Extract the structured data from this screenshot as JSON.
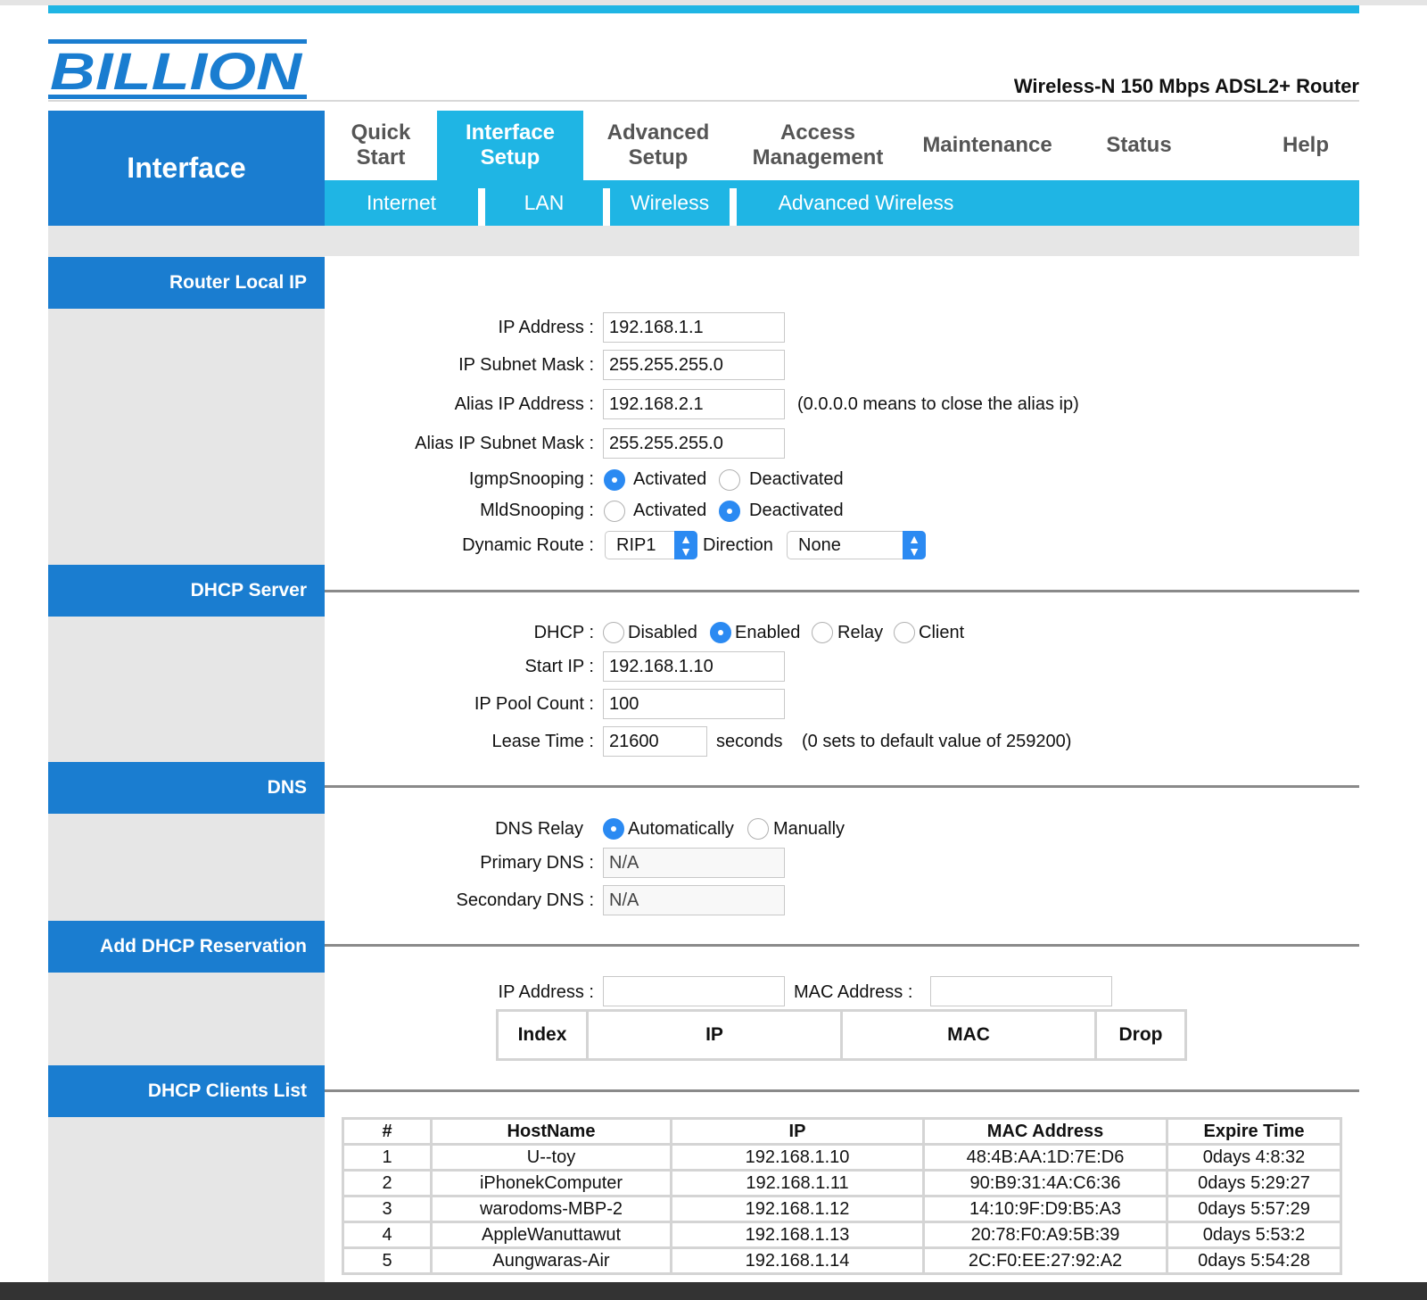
{
  "brand": {
    "logo_text": "BILLION",
    "product": "Wireless-N 150 Mbps ADSL2+ Router"
  },
  "nav": {
    "section": "Interface",
    "items": [
      {
        "label": "Quick\nStart"
      },
      {
        "label": "Interface\nSetup"
      },
      {
        "label": "Advanced\nSetup"
      },
      {
        "label": "Access\nManagement"
      },
      {
        "label": "Maintenance"
      },
      {
        "label": "Status"
      },
      {
        "label": "Help"
      }
    ],
    "subitems": [
      "Internet",
      "LAN",
      "Wireless",
      "Advanced Wireless"
    ]
  },
  "router_local_ip": {
    "header": "Router Local IP",
    "ip_label": "IP Address :",
    "ip": "192.168.1.1",
    "mask_label": "IP Subnet Mask :",
    "mask": "255.255.255.0",
    "alias_ip_label": "Alias IP Address :",
    "alias_ip": "192.168.2.1",
    "alias_note": "(0.0.0.0 means to close the alias ip)",
    "alias_mask_label": "Alias IP Subnet Mask :",
    "alias_mask": "255.255.255.0",
    "igmp_label": "IgmpSnooping :",
    "mld_label": "MldSnooping :",
    "activated": "Activated",
    "deactivated": "Deactivated",
    "igmp_value": "Activated",
    "mld_value": "Deactivated",
    "route_label": "Dynamic Route :",
    "route_value": "RIP1",
    "direction_label": "Direction",
    "direction_value": "None"
  },
  "dhcp_server": {
    "header": "DHCP Server",
    "dhcp_label": "DHCP :",
    "options": [
      "Disabled",
      "Enabled",
      "Relay",
      "Client"
    ],
    "selected": "Enabled",
    "start_ip_label": "Start IP :",
    "start_ip": "192.168.1.10",
    "pool_label": "IP Pool Count :",
    "pool": "100",
    "lease_label": "Lease Time :",
    "lease": "21600",
    "seconds": "seconds",
    "lease_note": "(0 sets to default value of 259200)"
  },
  "dns": {
    "header": "DNS",
    "relay_label": "DNS Relay",
    "auto": "Automatically",
    "manual": "Manually",
    "selected": "Automatically",
    "primary_label": "Primary DNS :",
    "primary": "N/A",
    "secondary_label": "Secondary DNS :",
    "secondary": "N/A"
  },
  "reservation": {
    "header": "Add DHCP Reservation",
    "ip_label": "IP Address :",
    "mac_label": "MAC Address :",
    "ip_value": "",
    "mac_value": "",
    "columns": [
      "Index",
      "IP",
      "MAC",
      "Drop"
    ]
  },
  "clients": {
    "header": "DHCP Clients List",
    "columns": [
      "#",
      "HostName",
      "IP",
      "MAC Address",
      "Expire Time"
    ],
    "rows": [
      [
        "1",
        "U--toy",
        "192.168.1.10",
        "48:4B:AA:1D:7E:D6",
        "0days 4:8:32"
      ],
      [
        "2",
        "iPhonekComputer",
        "192.168.1.11",
        "90:B9:31:4A:C6:36",
        "0days 5:29:27"
      ],
      [
        "3",
        "warodoms-MBP-2",
        "192.168.1.12",
        "14:10:9F:D9:B5:A3",
        "0days 5:57:29"
      ],
      [
        "4",
        "AppleWanuttawut",
        "192.168.1.13",
        "20:78:F0:A9:5B:39",
        "0days 5:53:2"
      ],
      [
        "5",
        "Aungwaras-Air",
        "192.168.1.14",
        "2C:F0:EE:27:92:A2",
        "0days 5:54:28"
      ]
    ]
  },
  "colors": {
    "accent": "#1fb5e4",
    "section": "#1a7dd0",
    "logo": "#1a7dd0"
  }
}
